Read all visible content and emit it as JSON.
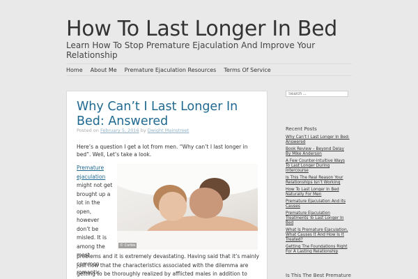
{
  "site": {
    "title": "How To Last Longer In Bed",
    "description": "Learn How To Stop Premature Ejaculation And Improve Your Relationship"
  },
  "nav": {
    "items": [
      "Home",
      "About Me",
      "Premature Ejaculation Resources",
      "Terms Of Service"
    ]
  },
  "post": {
    "title": "Why Can’t I Last Longer In Bed: Answered",
    "meta_prefix": "Posted on",
    "date": "February 5, 2016",
    "meta_by": "by",
    "author": "Dwight Mainstreet",
    "intro": "Here’s a question I get a lot from men. “Why can’t I last longer in bed”. Well, Let’s take a look.",
    "link_text": "Premature ejaculation",
    "left_text": "might not get brought up a lot in the open, however don’t be misled. It is among the most common romantic",
    "body_text": "problems and it is extremely devastating. Having said that it’s mainly just now that the characteristics associated with the dilemma are getting to be thoroughly realized by afflicted males in addition to industry experts from",
    "image_credit": "© Corbis"
  },
  "sidebar": {
    "search_placeholder": "Search ...",
    "recent_title": "Recent Posts",
    "recent_posts": [
      "Why Can’t I Last Longer In Bed: Answered",
      "Book Review – Beyond Delay By Mike Anderson",
      "A Few Counter-Intuitive Ways To Last Longer During Intercourse",
      "Is This The Real Reason Your Relationships Isn’t Working",
      "How To Last Longer In Bed Naturally For Men",
      "Premature Ejaculation And Its Causes",
      "Premature Ejaculation Treatments To Last Longer In Bed",
      "What Is Premature Ejaculation, What Causes It And How Is It Treated?",
      "Getting The Foundations Right For A Lasting Relationship"
    ],
    "next_title": "Is This The Best Premature"
  }
}
